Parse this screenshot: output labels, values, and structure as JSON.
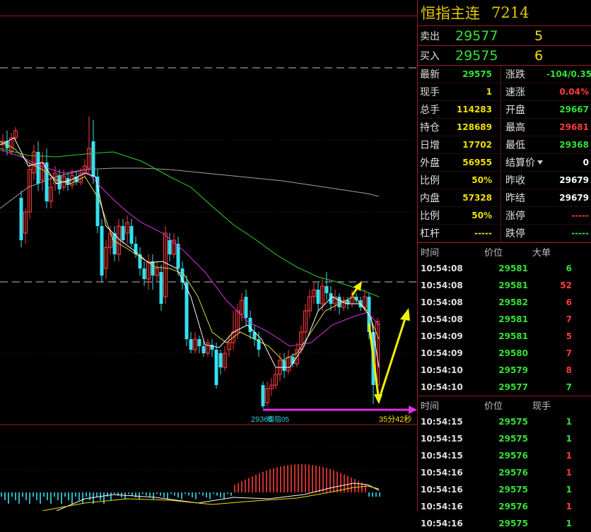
{
  "header": {
    "title": "恒指主连",
    "code": "7214"
  },
  "ask": {
    "label": "卖出",
    "price": "29577",
    "volume": "5"
  },
  "bid": {
    "label": "买入",
    "price": "29575",
    "volume": "6"
  },
  "quote": [
    {
      "l1": "最新",
      "v1": "29575",
      "c1": "g",
      "l2": "涨跌",
      "v2": "-104/0.35%",
      "c2": "g"
    },
    {
      "l1": "现手",
      "v1": "1",
      "c1": "y",
      "l2": "速涨",
      "v2": "0.04%",
      "c2": "r"
    },
    {
      "l1": "总手",
      "v1": "114283",
      "c1": "y",
      "l2": "开盘",
      "v2": "29667",
      "c2": "g"
    },
    {
      "l1": "持仓",
      "v1": "128689",
      "c1": "y",
      "l2": "最高",
      "v2": "29681",
      "c2": "r"
    },
    {
      "l1": "日增",
      "v1": "17702",
      "c1": "y",
      "l2": "最低",
      "v2": "29368",
      "c2": "g"
    },
    {
      "l1": "外盘",
      "v1": "56955",
      "c1": "y",
      "l2": "结算价",
      "v2": "0",
      "c2": "w"
    },
    {
      "l1": "比例",
      "v1": "50%",
      "c1": "y",
      "l2": "昨收",
      "v2": "29679",
      "c2": "w"
    },
    {
      "l1": "内盘",
      "v1": "57328",
      "c1": "y",
      "l2": "昨结",
      "v2": "29679",
      "c2": "w"
    },
    {
      "l1": "比例",
      "v1": "50%",
      "c1": "y",
      "l2": "涨停",
      "v2": "-----",
      "c2": "r"
    },
    {
      "l1": "杠杆",
      "v1": "-----",
      "c1": "y",
      "l2": "跌停",
      "v2": "-----",
      "c2": "g"
    }
  ],
  "big_orders": {
    "headers": [
      "时间",
      "价位",
      "大单"
    ],
    "rows": [
      {
        "time": "10:54:08",
        "price": "29581",
        "qty": "6",
        "color": "g"
      },
      {
        "time": "10:54:08",
        "price": "29581",
        "qty": "52",
        "color": "r"
      },
      {
        "time": "10:54:08",
        "price": "29582",
        "qty": "6",
        "color": "r"
      },
      {
        "time": "10:54:08",
        "price": "29581",
        "qty": "7",
        "color": "r"
      },
      {
        "time": "10:54:09",
        "price": "29581",
        "qty": "5",
        "color": "r"
      },
      {
        "time": "10:54:09",
        "price": "29580",
        "qty": "7",
        "color": "r"
      },
      {
        "time": "10:54:10",
        "price": "29579",
        "qty": "8",
        "color": "r"
      },
      {
        "time": "10:54:10",
        "price": "29577",
        "qty": "7",
        "color": "g"
      }
    ]
  },
  "ticks": {
    "headers": [
      "时间",
      "价位",
      "现手"
    ],
    "rows": [
      {
        "time": "10:54:15",
        "price": "29575",
        "qty": "1",
        "color": "g"
      },
      {
        "time": "10:54:15",
        "price": "29575",
        "qty": "1",
        "color": "g"
      },
      {
        "time": "10:54:15",
        "price": "29576",
        "qty": "1",
        "color": "r"
      },
      {
        "time": "10:54:16",
        "price": "29576",
        "qty": "1",
        "color": "r"
      },
      {
        "time": "10:54:16",
        "price": "29575",
        "qty": "1",
        "color": "g"
      },
      {
        "time": "10:54:16",
        "price": "29576",
        "qty": "1",
        "color": "r"
      },
      {
        "time": "10:54:16",
        "price": "29575",
        "qty": "1",
        "color": "g"
      }
    ]
  },
  "chart_labels": {
    "low_label": "29368",
    "axis_label": "恒指05",
    "countdown": "35分42秒"
  },
  "colors": {
    "up": "#ff3b3b",
    "down": "#35e0f0",
    "bg": "#000000",
    "grid": "#9b1b1b"
  }
}
